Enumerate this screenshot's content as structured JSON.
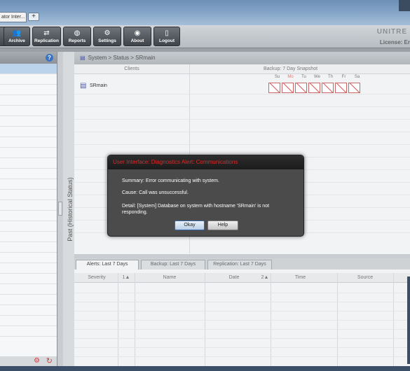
{
  "browser": {
    "tab_title": "ator Inter...",
    "new_tab_symbol": "+"
  },
  "toolbar": {
    "buttons": [
      {
        "label": "",
        "icon": "monitor-icon"
      },
      {
        "label": "Archive",
        "icon": "people-icon"
      },
      {
        "label": "Replication",
        "icon": "replication-icon"
      },
      {
        "label": "Reports",
        "icon": "globe-icon"
      },
      {
        "label": "Settings",
        "icon": "gears-icon"
      },
      {
        "label": "About",
        "icon": "info-icon"
      },
      {
        "label": "Logout",
        "icon": "logout-icon"
      }
    ],
    "brand": "UNITRE",
    "license": "License: Er"
  },
  "left_panel": {
    "help_symbol": "?"
  },
  "vertical_label": "Past (Historical Status)",
  "breadcrumb": "System  >  Status  >  SRmain",
  "columns": {
    "clients": "Clients",
    "backup": "Backup: 7 Day Snapshot",
    "days": [
      "Su",
      "Mo",
      "Tu",
      "We",
      "Th",
      "Fr",
      "Sa"
    ],
    "highlight_day_index": 1
  },
  "client": {
    "name": "SRmain",
    "icon": "server-icon",
    "snapshot_status": [
      "failed",
      "failed",
      "failed",
      "failed",
      "failed",
      "failed",
      "failed"
    ]
  },
  "bottom_tabs": [
    "Alerts: Last 7 Days",
    "Backup: Last 7 Days",
    "Replication: Last 7 Days"
  ],
  "alert_table": {
    "headers": [
      "Severity",
      "1▲",
      "Name",
      "Date",
      "2▲",
      "Time",
      "Source"
    ]
  },
  "dialog": {
    "title": "User Interface: Diagnostics Alert: Communications",
    "summary": "Summary: Error communicating with system.",
    "cause": "Cause: Call was unsuccessful.",
    "detail_line1": "Detail: [System] Database on system with hostname 'SRmain' is not",
    "detail_line2": "responding.",
    "okay_label": "Okay",
    "help_label": "Help",
    "title_color": "#e12727"
  }
}
